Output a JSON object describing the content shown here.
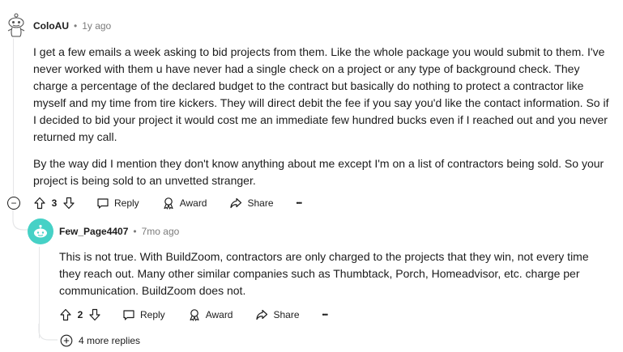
{
  "comment": {
    "author": "ColoAU",
    "separator": "•",
    "time": "1y ago",
    "paragraphs": [
      "I get a few emails a week asking to bid projects from them. Like the whole package you would submit to them. I've never worked with them u have never had a single check on a project or any type of background check. They charge a percentage of the declared budget to the contract but basically do nothing to protect a contractor like myself and my time from tire kickers. They will direct debit the fee if you say you'd like the contact information. So if I decided to bid your project it would cost me an immediate few hundred bucks even if I reached out and you never returned my call.",
      "By the way did I mention they don't know anything about me except I'm on a list of contractors being sold. So your project is being sold to an unvetted stranger."
    ],
    "score": "3",
    "reply_label": "Reply",
    "award_label": "Award",
    "share_label": "Share",
    "more_label": "•••",
    "collapse_label": "−"
  },
  "reply": {
    "author": "Few_Page4407",
    "separator": "•",
    "time": "7mo ago",
    "paragraphs": [
      "This is not true. With BuildZoom, contractors are only charged to the projects that they win, not every time they reach out. Many other similar companies such as Thumbtack, Porch, Homeadvisor, etc. charge per communication. BuildZoom does not."
    ],
    "score": "2",
    "reply_label": "Reply",
    "award_label": "Award",
    "share_label": "Share",
    "more_label": "•••"
  },
  "more_replies": {
    "label": "4 more replies",
    "icon": "plus-circle-icon"
  },
  "colors": {
    "reply_avatar_bg": "#46d1c6",
    "thread_line": "#e5e6e8",
    "meta_text": "#7c7c7c"
  }
}
